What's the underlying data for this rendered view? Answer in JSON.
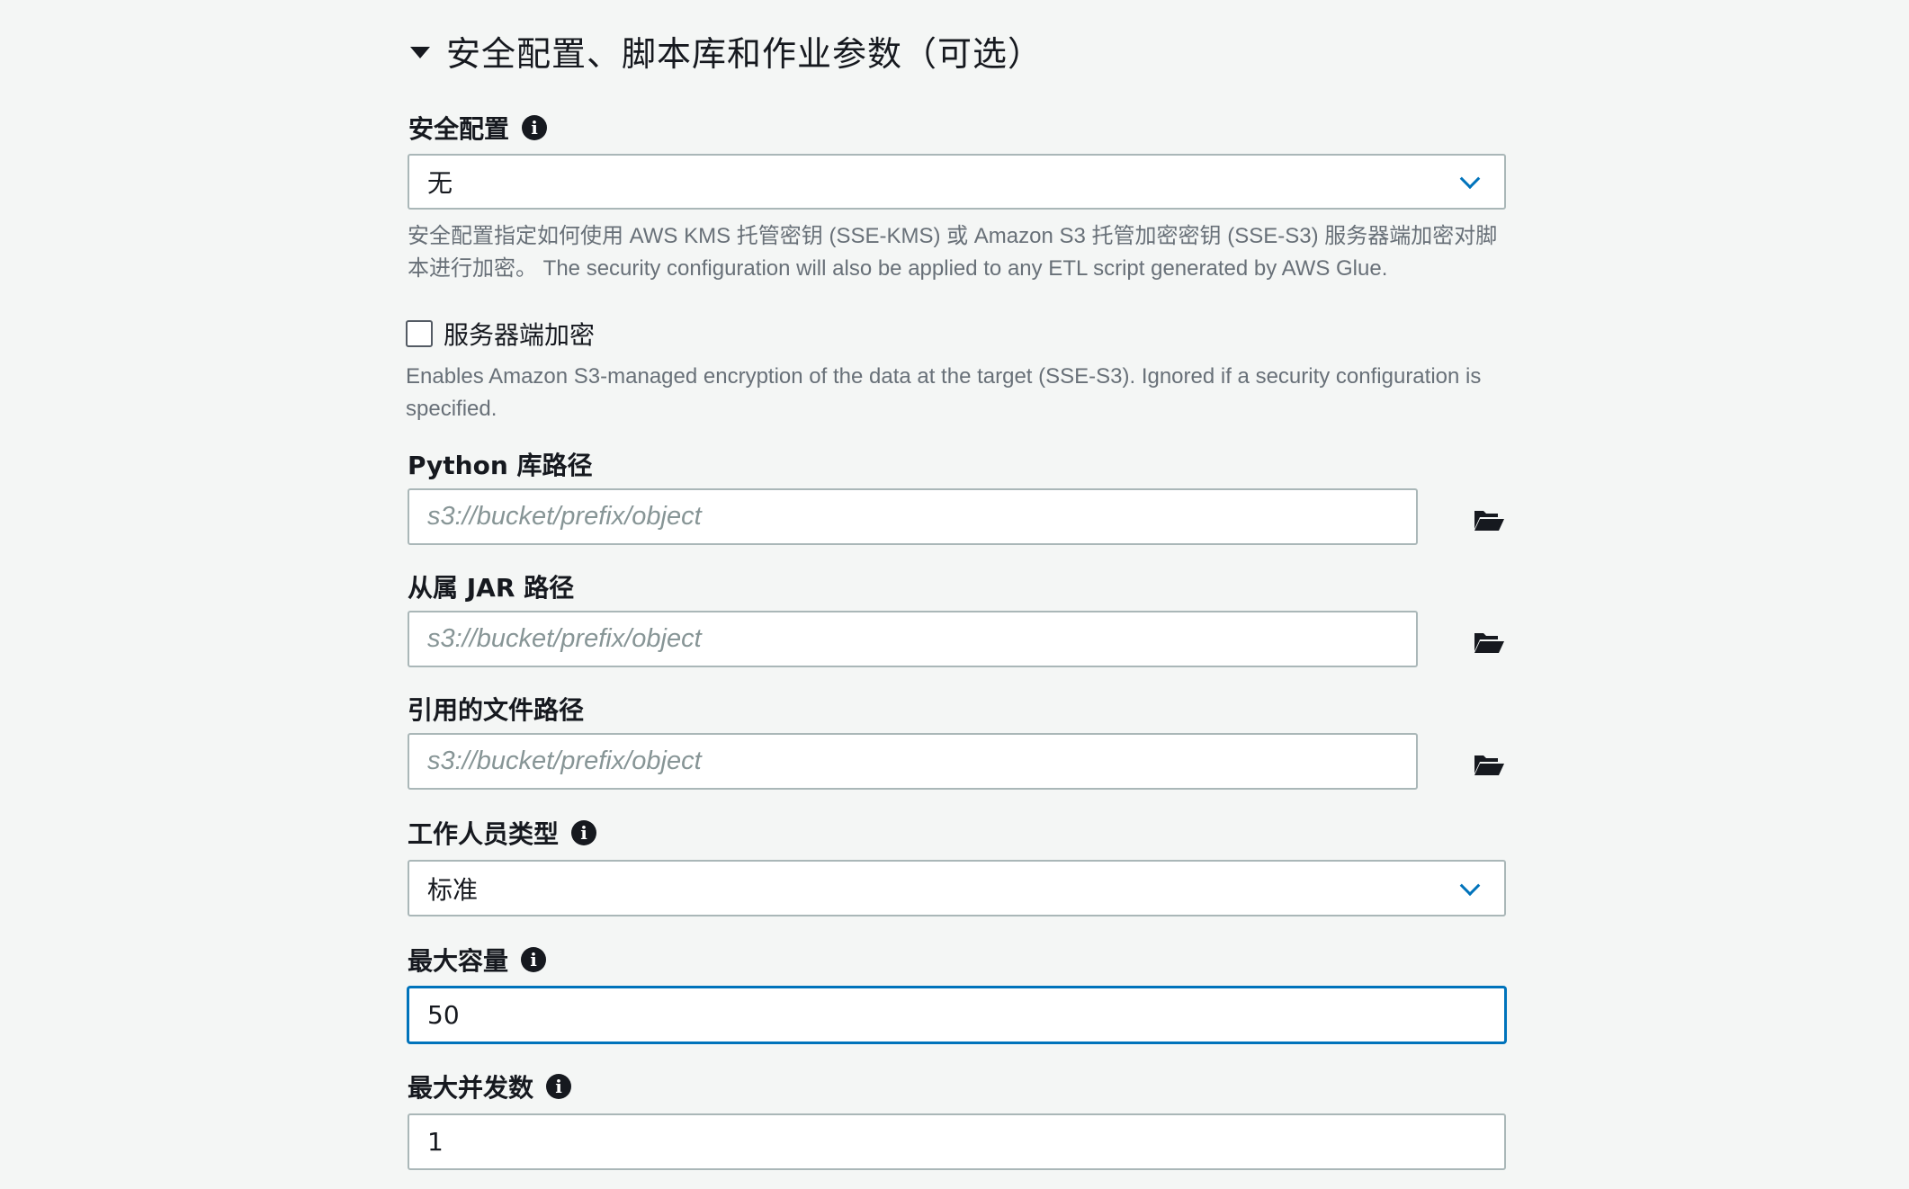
{
  "section": {
    "title": "安全配置、脚本库和作业参数（可选）"
  },
  "security_config": {
    "label": "安全配置",
    "value": "无",
    "help": "安全配置指定如何使用 AWS KMS 托管密钥 (SSE-KMS) 或 Amazon S3 托管加密密钥 (SSE-S3) 服务器端加密对脚本进行加密。 The security configuration will also be applied to any ETL script generated by AWS Glue.",
    "help_line1": "安全配置指定如何使用 AWS KMS 托管密钥 (SSE-KMS) 或 Amazon S3 托管加密密钥 (SSE-S3) 服务器端加密对脚",
    "help_line2": "本进行加密。 The security configuration will also be applied to any ETL script generated by AWS Glue."
  },
  "sse": {
    "label": "服务器端加密",
    "checked": false,
    "help_line1": "Enables Amazon S3-managed encryption of the data at the target (SSE-S3). Ignored if a security configuration is",
    "help_line2": "specified."
  },
  "python_lib": {
    "label": "Python 库路径",
    "placeholder": "s3://bucket/prefix/object",
    "value": ""
  },
  "jar_path": {
    "label": "从属 JAR 路径",
    "placeholder": "s3://bucket/prefix/object",
    "value": ""
  },
  "files_path": {
    "label": "引用的文件路径",
    "placeholder": "s3://bucket/prefix/object",
    "value": ""
  },
  "worker_type": {
    "label": "工作人员类型",
    "value": "标准"
  },
  "max_capacity": {
    "label": "最大容量",
    "value": "50"
  },
  "max_concurrency": {
    "label": "最大并发数",
    "value": "1"
  },
  "icons": {
    "caret": "caret-down-icon",
    "info": "info-icon",
    "chevron": "chevron-down-icon",
    "folder": "folder-open-icon"
  },
  "colors": {
    "background": "#f4f6f5",
    "accent": "#0073bb",
    "border": "#aab7b8",
    "help_text": "#687078",
    "placeholder": "#879596"
  }
}
